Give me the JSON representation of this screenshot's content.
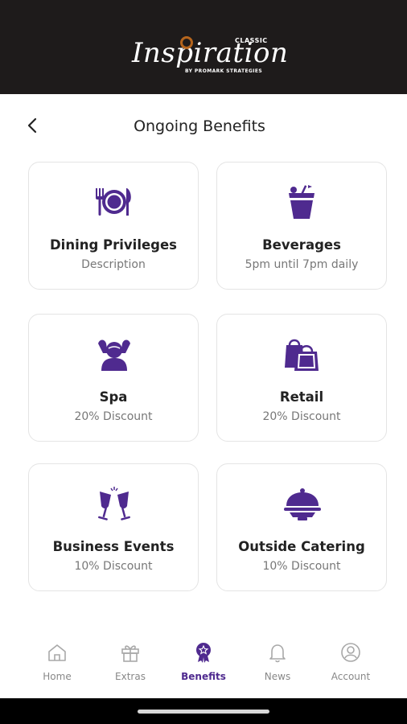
{
  "brand": {
    "name": "Inspiration",
    "edition": "CLASSIC",
    "byline": "BY PROMARK STRATEGIES",
    "header_bg": "#1e1b1b",
    "accent": "#4f2a8f"
  },
  "page": {
    "title": "Ongoing Benefits",
    "back_icon": "chevron-left-icon"
  },
  "benefits": [
    {
      "name": "Dining Privileges",
      "description": "Description",
      "icon": "plate-cutlery-icon"
    },
    {
      "name": "Beverages",
      "description": "5pm until 7pm daily",
      "icon": "cocktail-glass-icon"
    },
    {
      "name": "Spa",
      "description": "20% Discount",
      "icon": "spa-massage-icon"
    },
    {
      "name": "Retail",
      "description": "20% Discount",
      "icon": "shopping-bags-icon"
    },
    {
      "name": "Business Events",
      "description": "10% Discount",
      "icon": "champagne-glasses-icon"
    },
    {
      "name": "Outside Catering",
      "description": "10% Discount",
      "icon": "cloche-icon"
    }
  ],
  "nav": {
    "active": "Benefits",
    "items": [
      {
        "label": "Home",
        "icon": "home-icon"
      },
      {
        "label": "Extras",
        "icon": "gift-icon"
      },
      {
        "label": "Benefits",
        "icon": "award-badge-icon"
      },
      {
        "label": "News",
        "icon": "bell-icon"
      },
      {
        "label": "Account",
        "icon": "user-circle-icon"
      }
    ]
  }
}
